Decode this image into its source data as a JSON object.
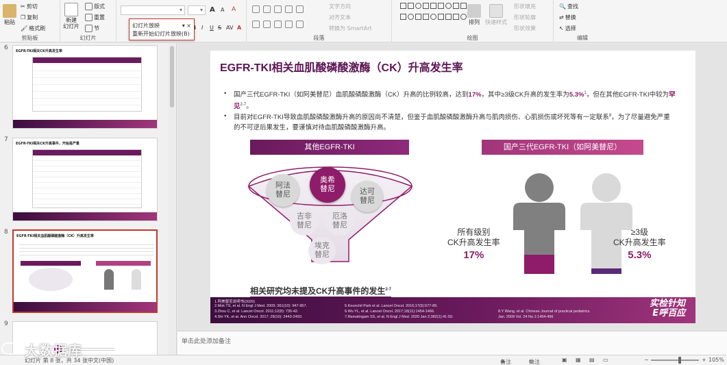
{
  "ribbon": {
    "clipboard": {
      "paste": "粘贴",
      "cut": "剪切",
      "copy": "复制",
      "format_painter": "格式刷",
      "label": "剪贴板"
    },
    "slides": {
      "new_slide": "新建\n幻灯片",
      "layout": "版式",
      "reset": "重置",
      "section": "节",
      "label": "幻灯片"
    },
    "font": {
      "grow": "A",
      "shrink": "A",
      "clear": "A",
      "bold": "B",
      "italic": "I",
      "underline": "U",
      "strike": "S",
      "spacing": "AV",
      "case": "Aa",
      "color": "A"
    },
    "paragraph": {
      "text_direction": "文字方向",
      "align_text": "对齐文本",
      "smartart": "转换为 SmartArt",
      "label": "段落"
    },
    "drawing": {
      "arrange": "排列",
      "quick_styles": "快速样式",
      "fill": "形状填充",
      "outline": "形状轮廓",
      "effects": "形状效果",
      "label": "绘图"
    },
    "editing": {
      "find": "查找",
      "replace": "替换",
      "select": "选择",
      "label": "编辑"
    }
  },
  "popup": {
    "title": "幻灯片放映",
    "item": "重新开始幻灯片放映(B)"
  },
  "slide_panel": {
    "numbers": [
      "6",
      "7",
      "8",
      "9"
    ],
    "thumb_titles": [
      "EGFR-TKI相关CK升高发生率",
      "EGFR-TKI相关CK升高事件，开始是严重",
      "EGFR-TKI相关血肌酸磷酸激酶（CK）升高发生率",
      ""
    ]
  },
  "slide": {
    "title": "EGFR-TKI相关血肌酸磷酸激酶（CK）升高发生率",
    "bullet1_a": "国产三代EGFR-TKI（如阿美替尼）血肌酸磷酸激酶（CK）升高的比例较高，达到",
    "bullet1_pct": "17%",
    "bullet1_b": "，其中≥3级CK升高的发生率为",
    "bullet1_pct2": "5.3%",
    "bullet1_sup": "1",
    "bullet1_c": "，但在其他EGFR-TKI中较为",
    "bullet1_rare": "罕见",
    "bullet1_sup2": "2-7",
    "bullet1_d": "。",
    "bullet2": "目前对EGFR-TKI导致血肌酸磷酸激酶升高的原因尚不清楚，但鉴于血肌酸磷酸激酶升高与肌肉损伤、心肌损伤或坏死等有一定联系",
    "bullet2_sup": "8",
    "bullet2_b": "，为了尽量避免严重的不可逆后果发生，要谨慎对待血肌酸磷酸激酶升高。",
    "left_band": "其他EGFR-TKI",
    "right_band": "国产三代EGFR-TKI（如阿美替尼）",
    "drugs": {
      "afatinib": "阿法\n替尼",
      "osimertinib": "奥希\n替尼",
      "dacomitinib": "达可\n替尼",
      "gefitinib": "吉非\n替尼",
      "erlotinib": "厄洛\n替尼",
      "icotinib": "埃克\n替尼"
    },
    "conclusion": "相关研究均未提及CK升高事件的发生",
    "conclusion_sup": "2-7",
    "stat_all_label": "所有级别\nCK升高发生率",
    "stat_all_value": "17%",
    "stat_g3_label": "≥3级\nCK升高发生率",
    "stat_g3_value": "5.3%",
    "refs": [
      "1.阿美替尼说明书(2020)",
      "2.Mok TS, et al. N Engl J Med. 2009; 361(10): 947-957.",
      "3.Zhou C, et al. Lancet Oncol. 2011;12(8): 735-42.",
      "4.Shi YK, et al. Ann Oncol. 2017; 28(10): 2443-2450.",
      "5.Keunchil Park et al. Lancet Oncol. 2016;17(5):577-89.",
      "6.Wu YL, et al. Lancet Oncol. 2017;18(11):1454-1466.",
      "7.Ramalingam SS, et al. N Engl J Med. 2020 Jan 2;382(1):41-50.",
      "8.Y Wang, et al. Chinese Journal of practical pediatrics.",
      "Jan. 2009 Vol. 24 No.1:1494-496"
    ],
    "slogan": "实检针知\n E呼百应"
  },
  "notes_placeholder": "单击此处添加备注",
  "status": {
    "slide_pos": "幻灯片 第 8 张，共 34 张",
    "language": "中文(中国)",
    "notes": "备注",
    "comments": "批注",
    "zoom": "105%"
  },
  "watermark": "大数据库",
  "colors": {
    "brand": "#5b1453",
    "accent": "#8e1c6a",
    "footer": "#6a1a5d"
  }
}
